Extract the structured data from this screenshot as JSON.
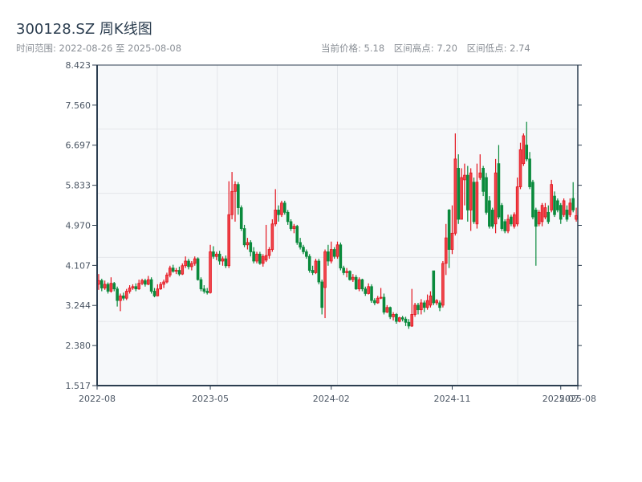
{
  "header": {
    "title": "300128.SZ 周K线图",
    "range_text": "时间范围: 2022-08-26 至 2025-08-08",
    "current_price": "当前价格: 5.18",
    "range_high": "区间高点: 7.20",
    "range_low": "区间低点: 2.74"
  },
  "colors": {
    "up": "#e3141e",
    "up_fill": "#f0454c",
    "down": "#0a8a3c",
    "plot_bg": "#f6f8fa",
    "grid": "#e3e6ea",
    "axis": "#2c3e50"
  },
  "chart_data": {
    "type": "candlestick",
    "title": "300128.SZ 周K线图",
    "ylim": [
      1.517,
      8.423
    ],
    "y_ticks": [
      "8.423",
      "7.560",
      "6.697",
      "5.833",
      "4.970",
      "4.107",
      "3.244",
      "2.380",
      "1.517"
    ],
    "x_ticks": [
      "2022-08",
      "2023-05",
      "2024-02",
      "2024-11",
      "2025-07",
      "2025-08"
    ],
    "grid": true,
    "fields": [
      "open",
      "high",
      "low",
      "close"
    ],
    "dates": [
      "2022-08-26",
      "2022-09-02",
      "2022-09-09",
      "2022-09-16",
      "2022-09-23",
      "2022-09-30",
      "2022-10-07",
      "2022-10-14",
      "2022-10-21",
      "2022-10-28",
      "2022-11-04",
      "2022-11-11",
      "2022-11-18",
      "2022-11-25",
      "2022-12-02",
      "2022-12-09",
      "2022-12-16",
      "2022-12-23",
      "2022-12-30",
      "2023-01-06",
      "2023-01-13",
      "2023-01-20",
      "2023-01-27",
      "2023-02-03",
      "2023-02-10",
      "2023-02-17",
      "2023-02-24",
      "2023-03-03",
      "2023-03-10",
      "2023-03-17",
      "2023-03-24",
      "2023-03-31",
      "2023-04-07",
      "2023-04-14",
      "2023-04-21",
      "2023-04-28",
      "2023-05-05",
      "2023-05-12",
      "2023-05-19",
      "2023-05-26",
      "2023-06-02",
      "2023-06-09",
      "2023-06-16",
      "2023-06-23",
      "2023-06-30",
      "2023-07-07",
      "2023-07-14",
      "2023-07-21",
      "2023-07-28",
      "2023-08-04",
      "2023-08-11",
      "2023-08-18",
      "2023-08-25",
      "2023-09-01",
      "2023-09-08",
      "2023-09-15",
      "2023-09-22",
      "2023-09-29",
      "2023-10-06",
      "2023-10-13",
      "2023-10-20",
      "2023-10-27",
      "2023-11-03",
      "2023-11-10",
      "2023-11-17",
      "2023-11-24",
      "2023-12-01",
      "2023-12-08",
      "2023-12-15",
      "2023-12-22",
      "2023-12-29",
      "2024-01-05",
      "2024-01-12",
      "2024-01-19",
      "2024-01-26",
      "2024-02-02",
      "2024-02-09",
      "2024-02-16",
      "2024-02-23",
      "2024-03-01",
      "2024-03-08",
      "2024-03-15",
      "2024-03-22",
      "2024-03-29",
      "2024-04-05",
      "2024-04-12",
      "2024-04-19",
      "2024-04-26",
      "2024-05-03",
      "2024-05-10",
      "2024-05-17",
      "2024-05-24",
      "2024-05-31",
      "2024-06-07",
      "2024-06-14",
      "2024-06-21",
      "2024-06-28",
      "2024-07-05",
      "2024-07-12",
      "2024-07-19",
      "2024-07-26",
      "2024-08-02",
      "2024-08-09",
      "2024-08-16",
      "2024-08-23",
      "2024-08-30",
      "2024-09-06",
      "2024-09-13",
      "2024-09-20",
      "2024-09-27",
      "2024-10-04",
      "2024-10-11",
      "2024-10-18",
      "2024-10-25",
      "2024-11-01",
      "2024-11-08",
      "2024-11-15",
      "2024-11-22",
      "2024-11-29",
      "2024-12-06",
      "2024-12-13",
      "2024-12-20",
      "2024-12-27",
      "2025-01-03",
      "2025-01-10",
      "2025-01-17",
      "2025-01-24",
      "2025-01-31",
      "2025-02-07",
      "2025-02-14",
      "2025-02-21",
      "2025-02-28",
      "2025-03-07",
      "2025-03-14",
      "2025-03-21",
      "2025-03-28",
      "2025-04-04",
      "2025-04-11",
      "2025-04-18",
      "2025-04-25",
      "2025-05-02",
      "2025-05-09",
      "2025-05-16",
      "2025-05-23",
      "2025-05-30",
      "2025-06-06",
      "2025-06-13",
      "2025-06-20",
      "2025-06-27",
      "2025-07-04",
      "2025-07-11",
      "2025-07-18",
      "2025-07-25",
      "2025-08-01",
      "2025-08-08"
    ],
    "ohlc": [
      [
        3.7,
        3.92,
        3.58,
        3.78
      ],
      [
        3.78,
        3.82,
        3.55,
        3.62
      ],
      [
        3.62,
        3.78,
        3.58,
        3.7
      ],
      [
        3.7,
        3.74,
        3.5,
        3.55
      ],
      [
        3.55,
        3.85,
        3.52,
        3.72
      ],
      [
        3.72,
        3.75,
        3.55,
        3.6
      ],
      [
        3.6,
        3.65,
        3.22,
        3.35
      ],
      [
        3.35,
        3.5,
        3.12,
        3.45
      ],
      [
        3.45,
        3.52,
        3.35,
        3.4
      ],
      [
        3.4,
        3.6,
        3.36,
        3.55
      ],
      [
        3.55,
        3.68,
        3.5,
        3.62
      ],
      [
        3.62,
        3.7,
        3.58,
        3.65
      ],
      [
        3.65,
        3.72,
        3.55,
        3.6
      ],
      [
        3.6,
        3.8,
        3.58,
        3.72
      ],
      [
        3.72,
        3.82,
        3.68,
        3.78
      ],
      [
        3.78,
        3.82,
        3.65,
        3.7
      ],
      [
        3.7,
        3.88,
        3.68,
        3.8
      ],
      [
        3.8,
        3.85,
        3.5,
        3.55
      ],
      [
        3.55,
        3.62,
        3.42,
        3.45
      ],
      [
        3.45,
        3.7,
        3.44,
        3.6
      ],
      [
        3.6,
        3.75,
        3.58,
        3.7
      ],
      [
        3.7,
        3.8,
        3.62,
        3.75
      ],
      [
        3.75,
        3.95,
        3.72,
        3.9
      ],
      [
        3.9,
        4.1,
        3.85,
        4.05
      ],
      [
        4.05,
        4.12,
        3.95,
        3.98
      ],
      [
        3.98,
        4.05,
        3.92,
        4.0
      ],
      [
        4.0,
        4.08,
        3.88,
        3.92
      ],
      [
        3.92,
        4.15,
        3.9,
        4.1
      ],
      [
        4.1,
        4.3,
        4.05,
        4.2
      ],
      [
        4.2,
        4.25,
        4.02,
        4.08
      ],
      [
        4.08,
        4.2,
        4.0,
        4.15
      ],
      [
        4.15,
        4.3,
        4.1,
        4.25
      ],
      [
        4.25,
        4.28,
        3.78,
        3.8
      ],
      [
        3.8,
        3.85,
        3.55,
        3.6
      ],
      [
        3.6,
        3.68,
        3.5,
        3.55
      ],
      [
        3.55,
        3.62,
        3.48,
        3.52
      ],
      [
        3.52,
        4.55,
        3.5,
        4.4
      ],
      [
        4.4,
        4.52,
        4.25,
        4.3
      ],
      [
        4.3,
        4.4,
        4.22,
        4.35
      ],
      [
        4.35,
        4.42,
        4.12,
        4.2
      ],
      [
        4.2,
        4.3,
        4.1,
        4.25
      ],
      [
        4.25,
        4.32,
        4.05,
        4.1
      ],
      [
        4.1,
        5.92,
        4.05,
        5.2
      ],
      [
        5.2,
        6.12,
        5.1,
        5.7
      ],
      [
        5.7,
        5.92,
        5.05,
        5.85
      ],
      [
        5.85,
        5.9,
        5.2,
        5.35
      ],
      [
        5.35,
        5.4,
        4.85,
        4.9
      ],
      [
        4.9,
        4.98,
        4.5,
        4.55
      ],
      [
        4.55,
        4.7,
        4.45,
        4.6
      ],
      [
        4.6,
        4.65,
        4.3,
        4.4
      ],
      [
        4.4,
        4.5,
        4.15,
        4.2
      ],
      [
        4.2,
        4.4,
        4.15,
        4.35
      ],
      [
        4.35,
        4.4,
        4.12,
        4.15
      ],
      [
        4.15,
        4.35,
        4.08,
        4.3
      ],
      [
        4.22,
        4.98,
        4.18,
        4.32
      ],
      [
        4.32,
        4.5,
        4.25,
        4.45
      ],
      [
        4.45,
        5.1,
        4.4,
        5.0
      ],
      [
        5.0,
        5.75,
        4.95,
        5.3
      ],
      [
        5.3,
        5.4,
        5.05,
        5.2
      ],
      [
        5.2,
        5.5,
        5.15,
        5.45
      ],
      [
        5.45,
        5.5,
        5.2,
        5.25
      ],
      [
        5.25,
        5.3,
        4.98,
        5.05
      ],
      [
        5.05,
        5.1,
        4.85,
        4.9
      ],
      [
        4.9,
        5.0,
        4.8,
        4.95
      ],
      [
        4.95,
        4.98,
        4.55,
        4.6
      ],
      [
        4.6,
        4.7,
        4.45,
        4.5
      ],
      [
        4.5,
        4.55,
        4.35,
        4.4
      ],
      [
        4.4,
        4.45,
        4.25,
        4.3
      ],
      [
        4.3,
        4.35,
        3.95,
        4.0
      ],
      [
        4.0,
        4.1,
        3.9,
        3.95
      ],
      [
        3.95,
        4.25,
        3.92,
        4.2
      ],
      [
        4.2,
        4.25,
        3.7,
        3.75
      ],
      [
        3.75,
        3.8,
        3.05,
        3.2
      ],
      [
        3.63,
        4.45,
        2.97,
        4.4
      ],
      [
        4.4,
        4.55,
        4.1,
        4.2
      ],
      [
        4.2,
        4.62,
        4.15,
        4.45
      ],
      [
        4.45,
        4.5,
        4.25,
        4.3
      ],
      [
        4.3,
        4.62,
        4.25,
        4.55
      ],
      [
        4.55,
        4.6,
        4.0,
        4.05
      ],
      [
        4.05,
        4.1,
        3.9,
        3.95
      ],
      [
        3.95,
        4.05,
        3.85,
        3.98
      ],
      [
        3.98,
        4.0,
        3.78,
        3.8
      ],
      [
        3.8,
        3.92,
        3.75,
        3.85
      ],
      [
        3.85,
        3.9,
        3.58,
        3.6
      ],
      [
        3.6,
        3.85,
        3.55,
        3.8
      ],
      [
        3.8,
        3.82,
        3.55,
        3.6
      ],
      [
        3.6,
        3.65,
        3.45,
        3.5
      ],
      [
        3.5,
        3.72,
        3.48,
        3.65
      ],
      [
        3.65,
        3.7,
        3.3,
        3.35
      ],
      [
        3.35,
        3.4,
        3.25,
        3.3
      ],
      [
        3.3,
        3.45,
        3.28,
        3.4
      ],
      [
        3.4,
        3.62,
        3.38,
        3.42
      ],
      [
        3.42,
        3.5,
        3.05,
        3.1
      ],
      [
        3.1,
        3.25,
        3.08,
        3.2
      ],
      [
        3.2,
        3.22,
        2.95,
        3.0
      ],
      [
        3.0,
        3.1,
        2.92,
        3.05
      ],
      [
        3.05,
        3.08,
        2.85,
        2.9
      ],
      [
        2.9,
        3.0,
        2.88,
        2.98
      ],
      [
        2.98,
        3.02,
        2.9,
        2.95
      ],
      [
        2.95,
        3.0,
        2.8,
        2.88
      ],
      [
        2.88,
        2.95,
        2.74,
        2.8
      ],
      [
        2.8,
        3.6,
        2.78,
        3.05
      ],
      [
        3.05,
        3.3,
        3.0,
        3.25
      ],
      [
        3.25,
        3.3,
        3.05,
        3.15
      ],
      [
        3.15,
        3.38,
        3.05,
        3.3
      ],
      [
        3.3,
        3.35,
        3.1,
        3.2
      ],
      [
        3.2,
        3.48,
        3.15,
        3.35
      ],
      [
        3.25,
        3.55,
        3.2,
        3.45
      ],
      [
        3.99,
        3.99,
        3.25,
        3.3
      ],
      [
        3.3,
        3.38,
        3.25,
        3.35
      ],
      [
        3.3,
        3.35,
        3.12,
        3.2
      ],
      [
        3.25,
        4.2,
        3.2,
        4.15
      ],
      [
        4.15,
        5.0,
        3.9,
        4.7
      ],
      [
        5.3,
        5.32,
        4.05,
        4.45
      ],
      [
        4.45,
        5.4,
        4.35,
        4.8
      ],
      [
        4.8,
        6.95,
        4.75,
        6.4
      ],
      [
        6.2,
        6.5,
        5.0,
        5.1
      ],
      [
        5.1,
        6.2,
        5.1,
        6.0
      ],
      [
        5.95,
        6.3,
        5.4,
        6.05
      ],
      [
        6.05,
        6.25,
        5.05,
        5.3
      ],
      [
        5.3,
        6.2,
        4.85,
        6.1
      ],
      [
        5.9,
        6.0,
        5.0,
        5.05
      ],
      [
        5.0,
        6.3,
        4.9,
        5.9
      ],
      [
        6.0,
        6.5,
        5.95,
        6.1
      ],
      [
        6.2,
        6.25,
        5.6,
        5.7
      ],
      [
        6.0,
        6.1,
        5.2,
        5.25
      ],
      [
        5.5,
        5.6,
        4.9,
        4.95
      ],
      [
        5.3,
        5.35,
        4.9,
        4.95
      ],
      [
        5.0,
        6.4,
        4.8,
        6.1
      ],
      [
        6.3,
        6.7,
        5.1,
        5.15
      ],
      [
        5.4,
        5.45,
        4.85,
        4.9
      ],
      [
        5.05,
        5.1,
        4.8,
        4.85
      ],
      [
        4.85,
        5.2,
        4.8,
        5.1
      ],
      [
        5.15,
        5.2,
        4.95,
        5.0
      ],
      [
        4.95,
        5.25,
        4.9,
        5.2
      ],
      [
        5.0,
        6.0,
        4.95,
        5.8
      ],
      [
        5.8,
        6.75,
        5.75,
        6.6
      ],
      [
        6.3,
        6.95,
        6.25,
        6.9
      ],
      [
        6.7,
        7.2,
        6.35,
        6.4
      ],
      [
        6.4,
        6.55,
        5.75,
        5.8
      ],
      [
        5.9,
        5.95,
        5.1,
        5.15
      ],
      [
        5.3,
        5.35,
        4.1,
        4.95
      ],
      [
        5.0,
        5.3,
        4.95,
        5.25
      ],
      [
        5.05,
        5.45,
        4.95,
        5.4
      ],
      [
        5.15,
        5.45,
        5.1,
        5.35
      ],
      [
        5.25,
        5.4,
        5.0,
        5.05
      ],
      [
        5.3,
        5.95,
        5.25,
        5.85
      ],
      [
        5.6,
        5.7,
        5.15,
        5.2
      ],
      [
        5.5,
        5.55,
        5.25,
        5.3
      ],
      [
        5.4,
        5.45,
        5.0,
        5.1
      ],
      [
        5.2,
        5.55,
        5.15,
        5.5
      ],
      [
        5.3,
        5.4,
        5.05,
        5.1
      ],
      [
        5.2,
        5.55,
        5.15,
        5.45
      ],
      [
        5.55,
        5.9,
        5.25,
        5.3
      ],
      [
        5.1,
        5.35,
        5.05,
        5.18
      ]
    ]
  }
}
